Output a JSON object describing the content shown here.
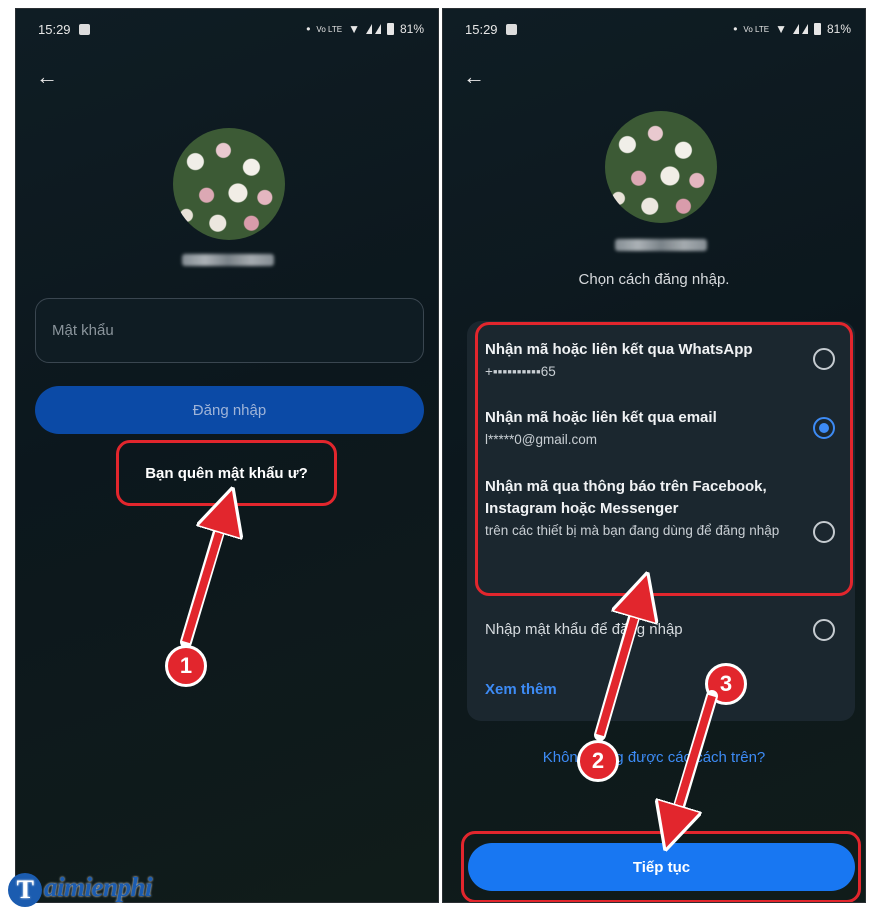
{
  "left_screen": {
    "status_time": "15:29",
    "status_battery": "81%",
    "back_label": "←",
    "password_placeholder": "Mật khẩu",
    "login_button": "Đăng nhập",
    "forgot_password": "Bạn quên mật khẩu ư?",
    "step_number": "1"
  },
  "right_screen": {
    "status_time": "15:29",
    "status_battery": "81%",
    "back_label": "←",
    "prompt": "Chọn cách đăng nhập.",
    "options": [
      {
        "title": "Nhận mã hoặc liên kết qua WhatsApp",
        "subtitle": "+▪▪▪▪▪▪▪▪▪▪65",
        "selected": false
      },
      {
        "title": "Nhận mã hoặc liên kết qua email",
        "subtitle": "l*****0@gmail.com",
        "selected": true
      },
      {
        "title": "Nhận mã qua thông báo trên Facebook, Instagram hoặc Messenger",
        "subtitle": "trên các thiết bị mà bạn đang dùng để đăng nhập",
        "selected": false
      },
      {
        "title": "Nhập mật khẩu để đăng nhập",
        "subtitle": "",
        "selected": false
      }
    ],
    "see_more": "Xem thêm",
    "cant_use": "Không dùng được các cách trên?",
    "continue_button": "Tiếp tục",
    "step_two": "2",
    "step_three": "3"
  },
  "watermark": {
    "logo_letter": "T",
    "logo_text": "aimienphi"
  },
  "colors": {
    "accent_blue": "#1877f2",
    "highlight_red": "#e2262d"
  }
}
